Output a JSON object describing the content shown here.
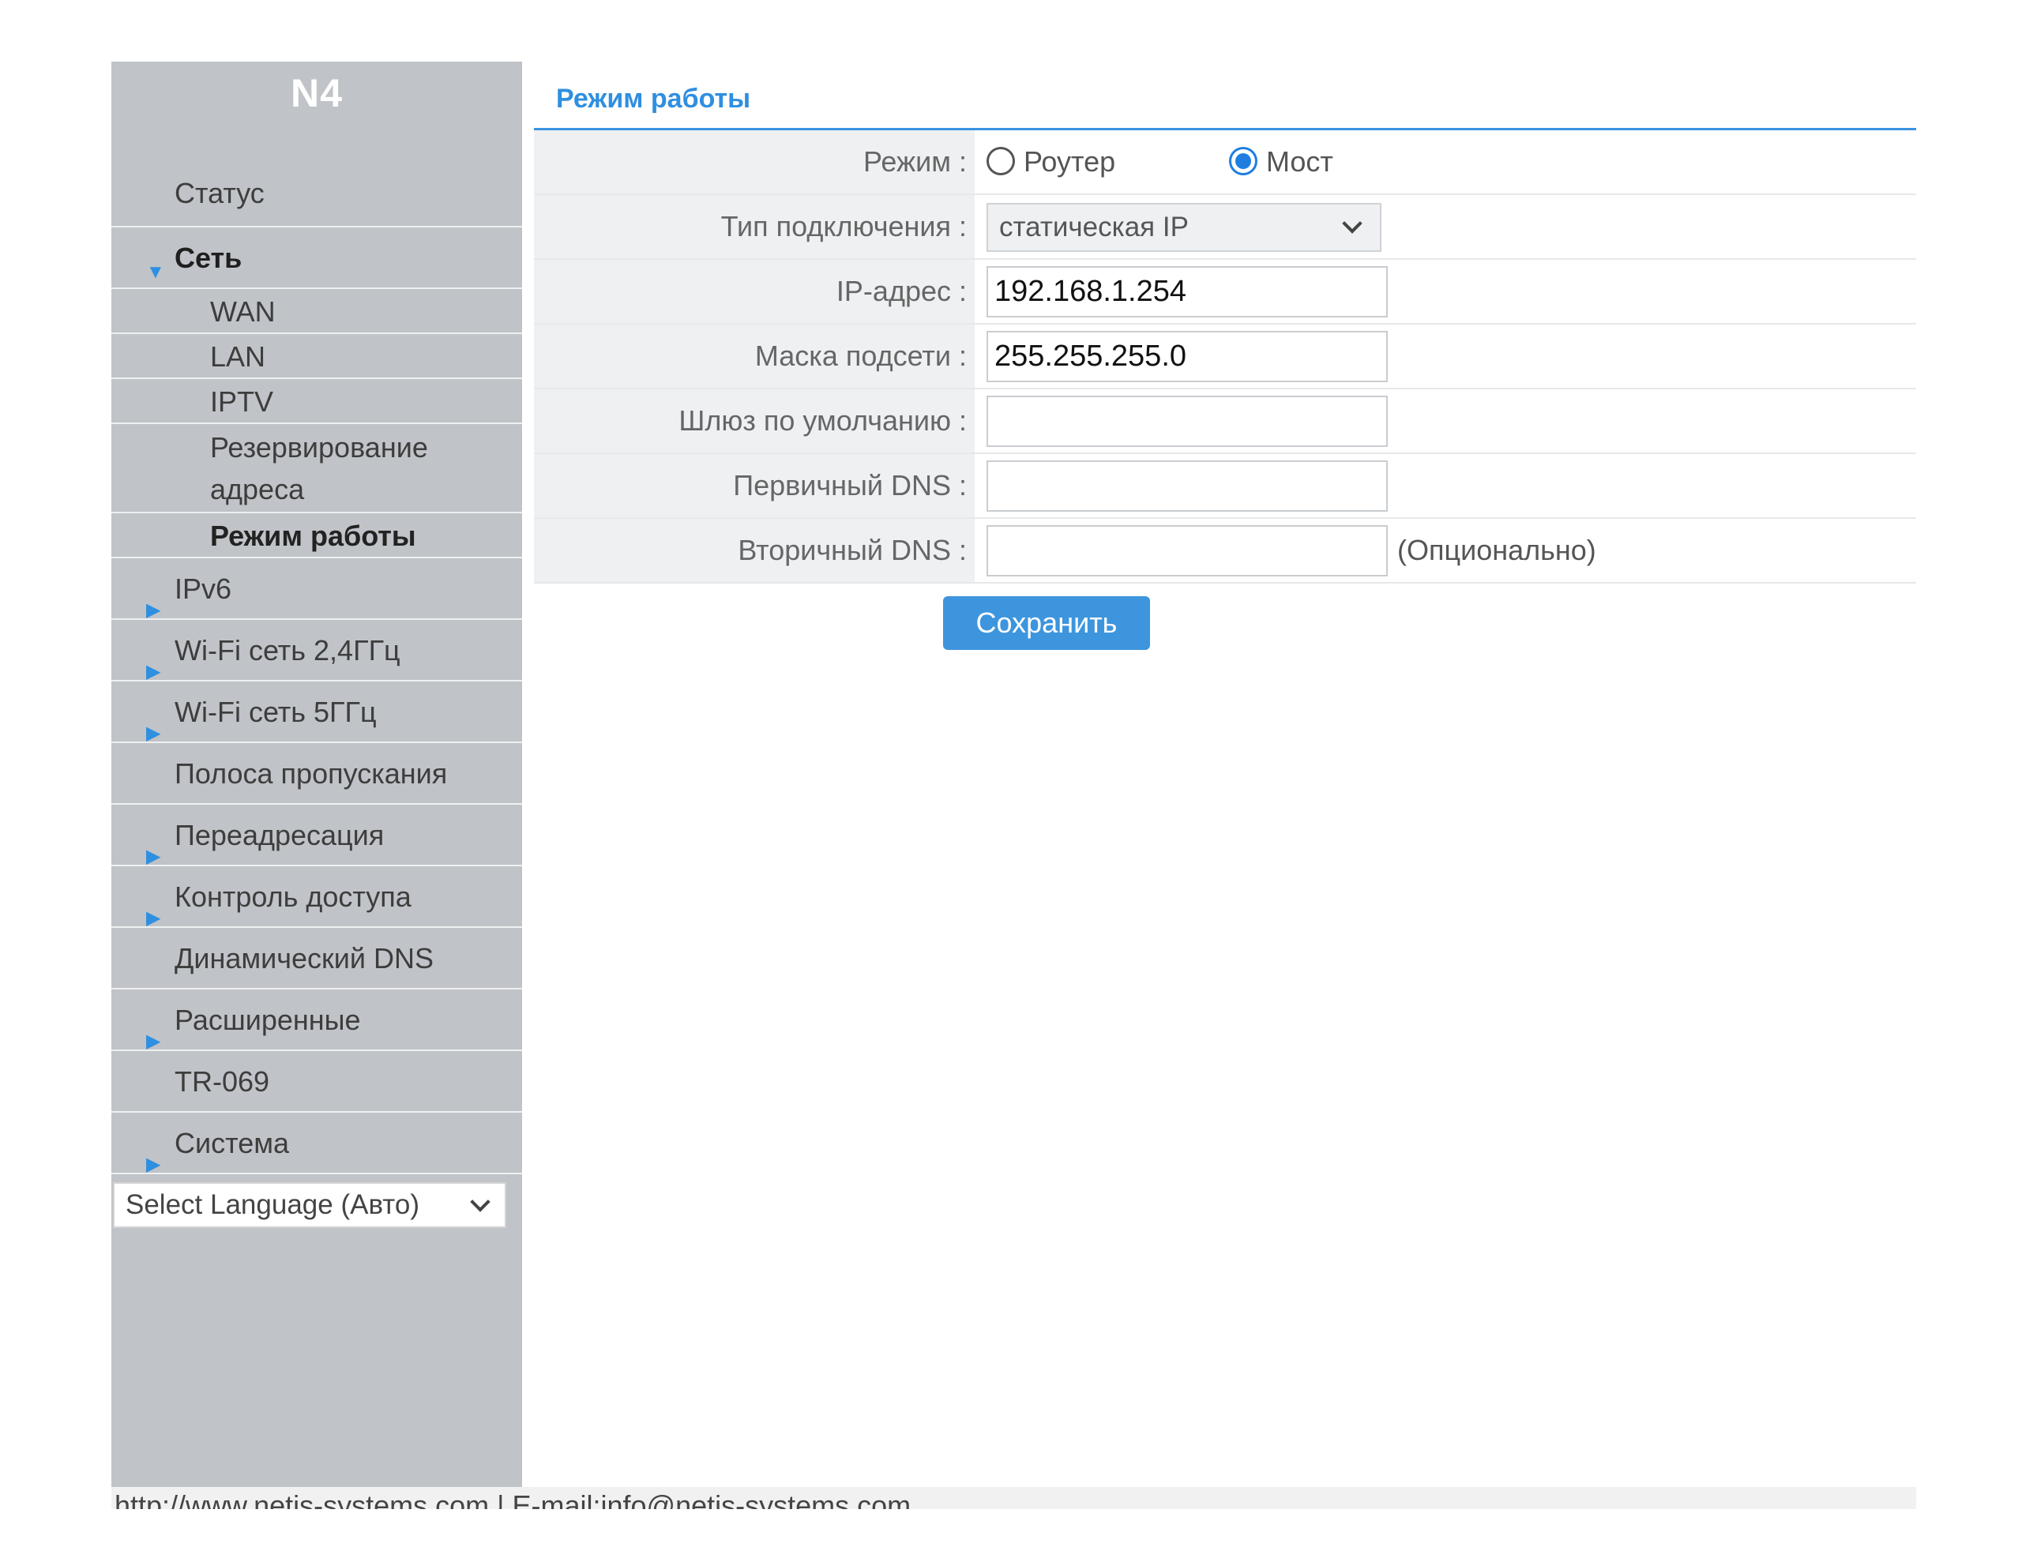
{
  "sidebar": {
    "brand": "N4",
    "status": "Статус",
    "network": "Сеть",
    "sub": {
      "wan": "WAN",
      "lan": "LAN",
      "iptv": "IPTV",
      "reserve_line1": "Резервирование",
      "reserve_line2": "адреса",
      "mode": "Режим работы"
    },
    "items": {
      "ipv6": "IPv6",
      "wifi24": "Wi-Fi сеть 2,4ГГц",
      "wifi5": "Wi-Fi сеть 5ГГц",
      "bandwidth": "Полоса пропускания",
      "forwarding": "Переадресация",
      "access": "Контроль доступа",
      "ddns": "Динамический DNS",
      "advanced": "Расширенные",
      "tr069": "TR-069",
      "system": "Система"
    },
    "language_selected": "Select Language (Авто)"
  },
  "main": {
    "title": "Режим работы",
    "labels": {
      "mode": "Режим :",
      "conn_type": "Тип подключения :",
      "ip": "IP-адрес :",
      "mask": "Маска подсети :",
      "gateway": "Шлюз по умолчанию :",
      "dns1": "Первичный DNS :",
      "dns2": "Вторичный DNS :"
    },
    "mode_options": {
      "router": "Роутер",
      "bridge": "Мост",
      "selected": "bridge"
    },
    "conn_type_selected": "статическая IP",
    "values": {
      "ip": "192.168.1.254",
      "mask": "255.255.255.0",
      "gateway": "",
      "dns1": "",
      "dns2": ""
    },
    "optional_hint": "(Опционально)",
    "save_label": "Сохранить"
  },
  "footer": {
    "text": "http://www.netis-systems.com | E-mail:info@netis-systems.com"
  },
  "icons": {
    "collapsed_arrow": "triangle-right-icon",
    "expanded_arrow": "triangle-down-icon",
    "dropdown": "chevron-down-icon"
  },
  "colors": {
    "accent": "#3d95dd",
    "sidebar_bg": "#c0c3c7",
    "label_bg": "#eef0f2"
  }
}
